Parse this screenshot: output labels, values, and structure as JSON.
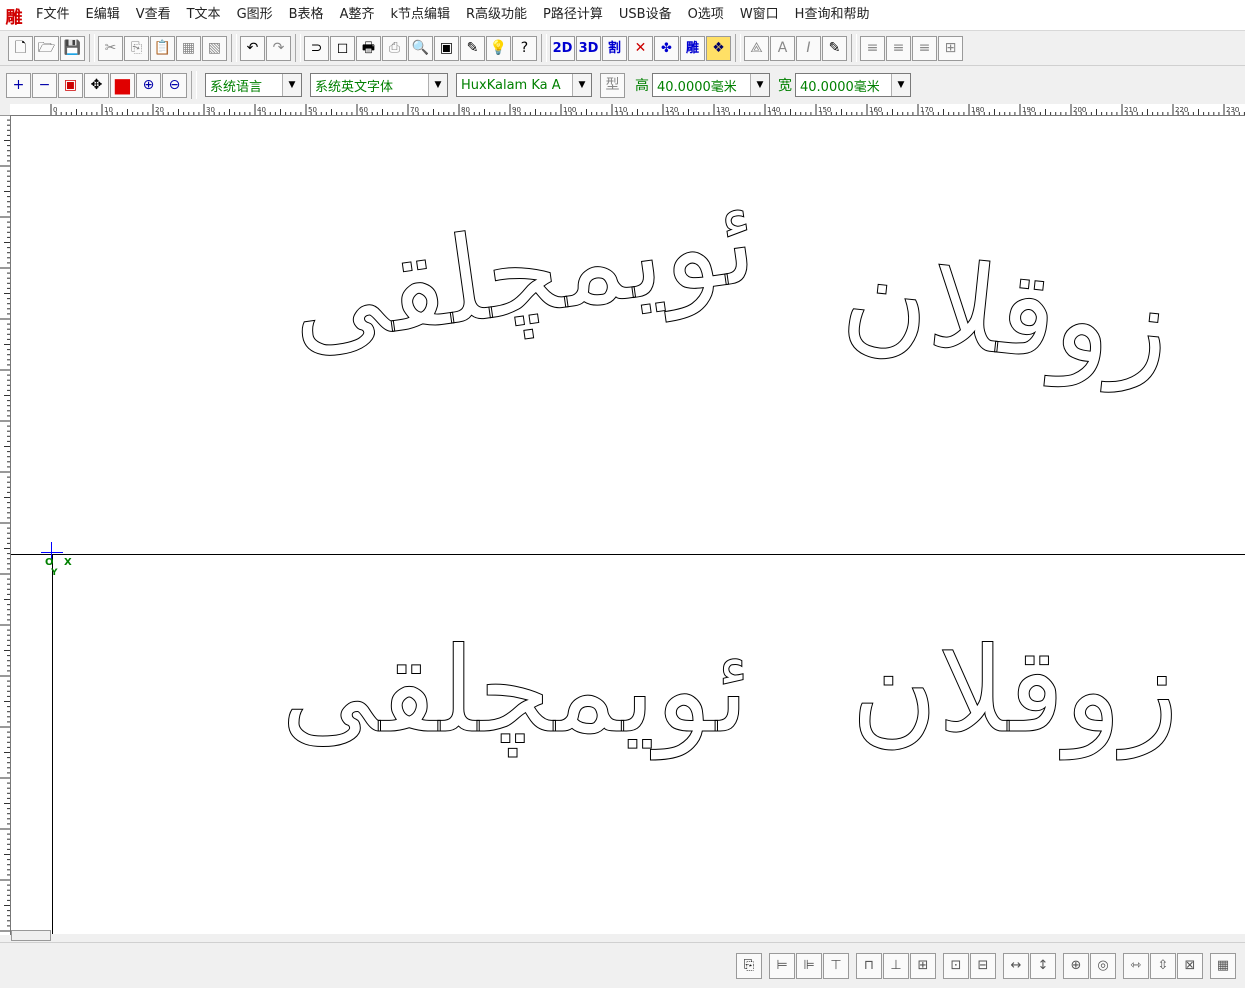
{
  "app": {
    "logo": "雕"
  },
  "menu": [
    "F文件",
    "E编辑",
    "V查看",
    "T文本",
    "G图形",
    "B表格",
    "A整齐",
    "k节点编辑",
    "R高级功能",
    "P路径计算",
    "USB设备",
    "O选项",
    "W窗口",
    "H查询和帮助"
  ],
  "toolbar1": {
    "file": [
      "🗋",
      "🗁",
      "💾"
    ],
    "edit": [
      "✂",
      "⎘",
      "📋",
      "▦",
      "▧"
    ],
    "history": [
      "↶",
      "↷"
    ],
    "tools": [
      "⊃",
      "◻",
      "🖶",
      "⎙",
      "🔍",
      "▣",
      "✎",
      "💡",
      "?"
    ],
    "modes": [
      "2D",
      "3D",
      "割",
      "✕",
      "✤",
      "雕",
      "❖"
    ],
    "format": [
      "⟁",
      "A",
      "I",
      "✎"
    ],
    "align": [
      "≡",
      "≡",
      "≡",
      "⊞"
    ]
  },
  "toolbar2": {
    "zoom": [
      "+",
      "−",
      "▣",
      "✥",
      "■",
      "⊕",
      "⊖"
    ],
    "language": "系统语言",
    "font_family_cn": "系统英文字体",
    "font_family": "HuxKalam Ka A",
    "style_button": "型",
    "height_label": "高",
    "height_value": "40.0000毫米",
    "width_label": "宽",
    "width_value": "40.0000毫米"
  },
  "ruler_labels": [
    "0",
    "10",
    "20",
    "30",
    "40",
    "50",
    "60",
    "70",
    "80",
    "90",
    "100",
    "110",
    "120",
    "130",
    "140",
    "150",
    "160",
    "170",
    "180",
    "190",
    "200",
    "210",
    "220",
    "230"
  ],
  "canvas": {
    "origin_o": "O",
    "origin_x": "X",
    "origin_y": "Y",
    "text_top_left": "ئويمچلقى",
    "text_top_right": "زوقلان",
    "text_bottom_left": "ئويمچلقى",
    "text_bottom_right": "زوقلان"
  },
  "bottombar": [
    "⎘",
    "⊨",
    "⊫",
    "⊤",
    "⊓",
    "⊥",
    "⊞",
    "⊡",
    "⊟",
    "↔",
    "↕",
    "⊕",
    "◎",
    "⇿",
    "⇳",
    "⊠",
    "▦"
  ]
}
